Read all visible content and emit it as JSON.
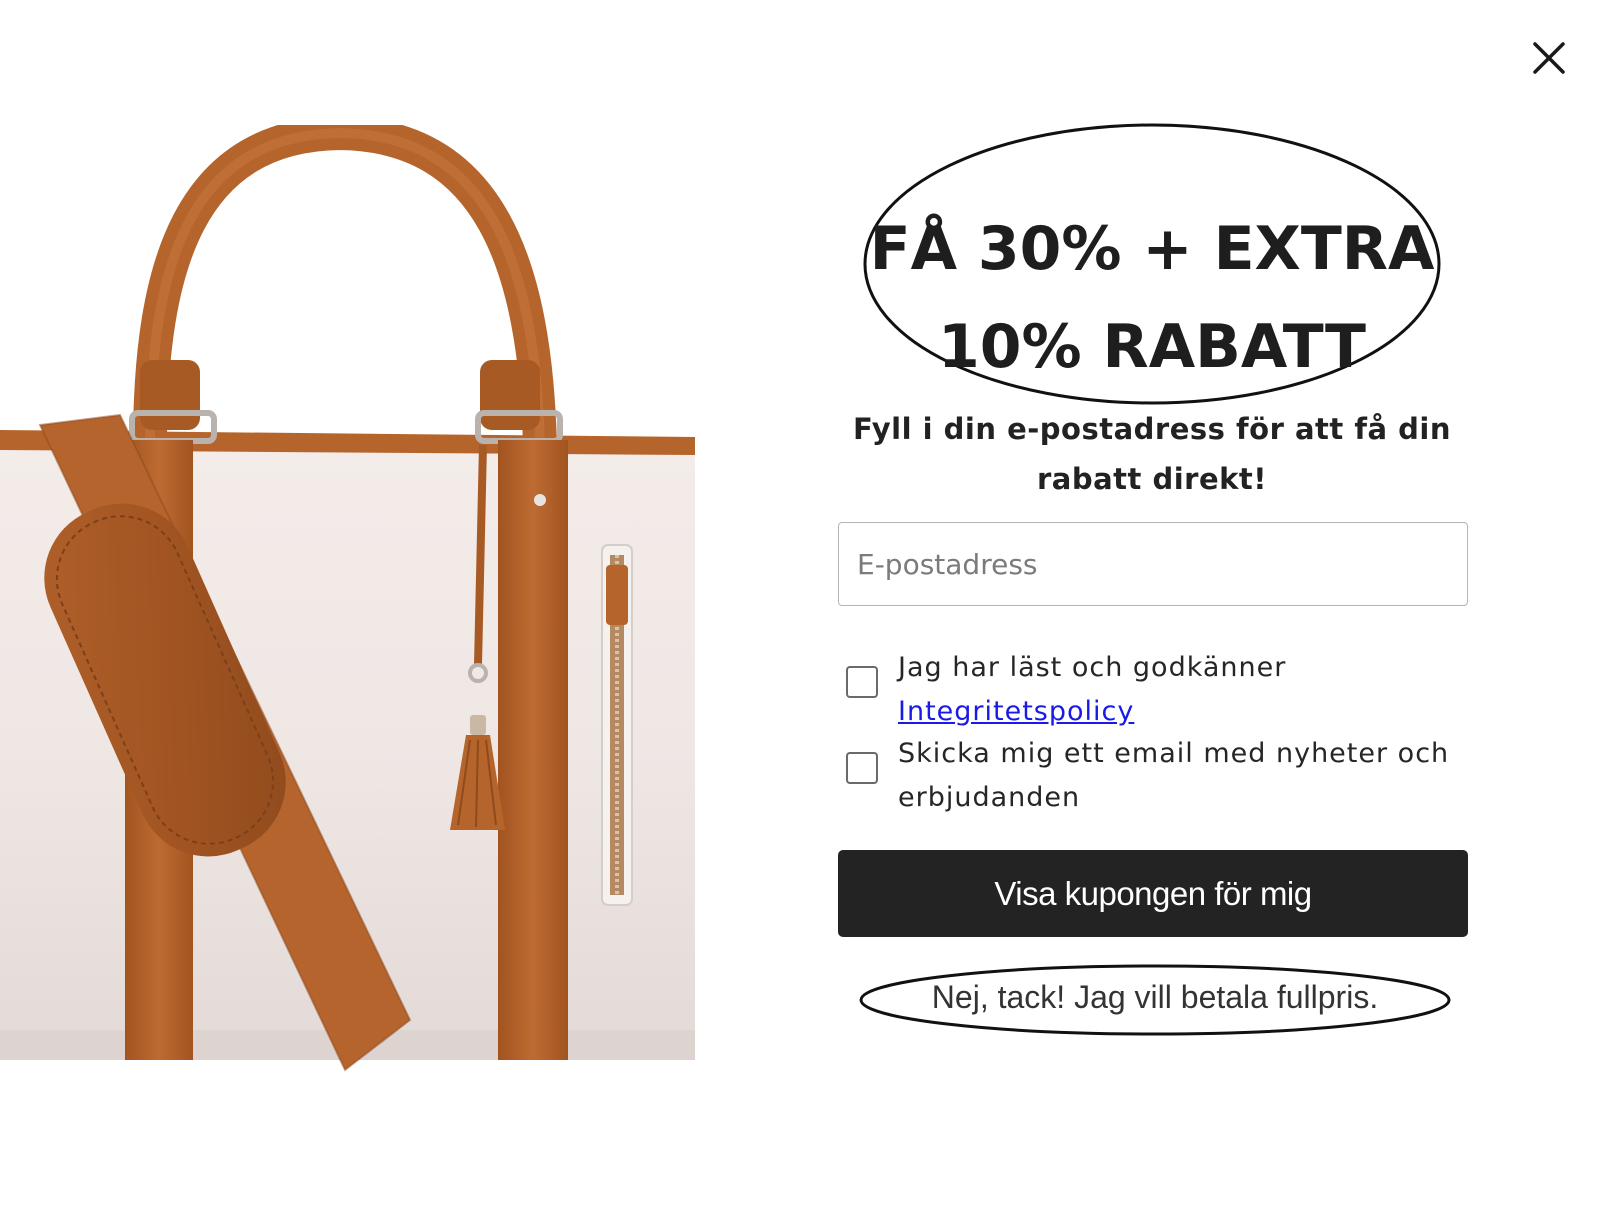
{
  "popup": {
    "close_icon": "close-icon",
    "product_image": "duffel-bag-product-image",
    "headline_line1": "FÅ 30% + EXTRA",
    "headline_line2": "10% RABATT",
    "subtitle_line1": "Fyll i din e-postadress för att få din",
    "subtitle_line2": "rabatt direkt!",
    "email": {
      "placeholder": "E-postadress",
      "value": ""
    },
    "consent_policy": {
      "text": "Jag har läst och godkänner",
      "link": "Integritetspolicy",
      "checked": false
    },
    "consent_newsletter": {
      "text_line1": "Skicka mig ett email med nyheter och",
      "text_line2": "erbjudanden",
      "checked": false
    },
    "submit_label": "Visa kupongen för mig",
    "decline_label": "Nej, tack! Jag vill betala fullpris."
  },
  "colors": {
    "button_bg": "#232323",
    "link": "#1a1ae6",
    "leather": "#b5652c",
    "bag_body": "#ede5e3"
  }
}
